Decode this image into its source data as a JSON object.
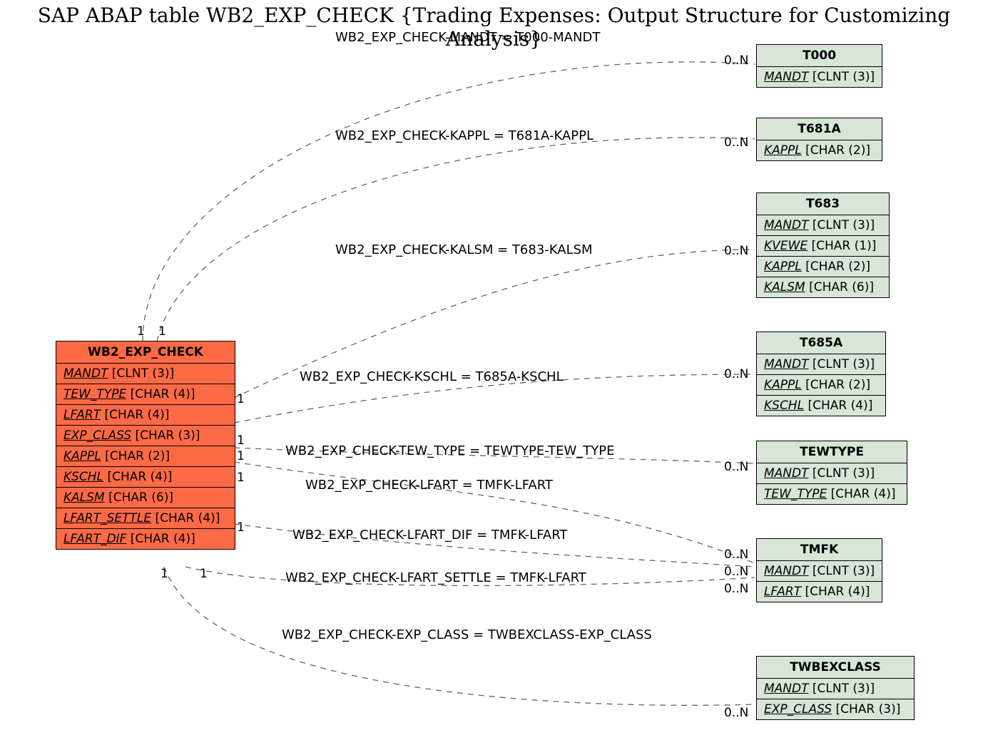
{
  "title": "SAP ABAP table WB2_EXP_CHECK {Trading Expenses: Output Structure for Customizing Analysis}",
  "source": {
    "name": "WB2_EXP_CHECK",
    "fields": [
      {
        "n": "MANDT",
        "t": "[CLNT (3)]"
      },
      {
        "n": "TEW_TYPE",
        "t": "[CHAR (4)]"
      },
      {
        "n": "LFART",
        "t": "[CHAR (4)]"
      },
      {
        "n": "EXP_CLASS",
        "t": "[CHAR (3)]"
      },
      {
        "n": "KAPPL",
        "t": "[CHAR (2)]"
      },
      {
        "n": "KSCHL",
        "t": "[CHAR (4)]"
      },
      {
        "n": "KALSM",
        "t": "[CHAR (6)]"
      },
      {
        "n": "LFART_SETTLE",
        "t": "[CHAR (4)]"
      },
      {
        "n": "LFART_DIF",
        "t": "[CHAR (4)]"
      }
    ]
  },
  "targets": {
    "t000": {
      "name": "T000",
      "fields": [
        {
          "n": "MANDT",
          "t": "[CLNT (3)]"
        }
      ]
    },
    "t681a": {
      "name": "T681A",
      "fields": [
        {
          "n": "KAPPL",
          "t": "[CHAR (2)]"
        }
      ]
    },
    "t683": {
      "name": "T683",
      "fields": [
        {
          "n": "MANDT",
          "t": "[CLNT (3)]"
        },
        {
          "n": "KVEWE",
          "t": "[CHAR (1)]"
        },
        {
          "n": "KAPPL",
          "t": "[CHAR (2)]"
        },
        {
          "n": "KALSM",
          "t": "[CHAR (6)]"
        }
      ]
    },
    "t685a": {
      "name": "T685A",
      "fields": [
        {
          "n": "MANDT",
          "t": "[CLNT (3)]"
        },
        {
          "n": "KAPPL",
          "t": "[CHAR (2)]"
        },
        {
          "n": "KSCHL",
          "t": "[CHAR (4)]"
        }
      ]
    },
    "tewtype": {
      "name": "TEWTYPE",
      "fields": [
        {
          "n": "MANDT",
          "t": "[CLNT (3)]"
        },
        {
          "n": "TEW_TYPE",
          "t": "[CHAR (4)]"
        }
      ]
    },
    "tmfk": {
      "name": "TMFK",
      "fields": [
        {
          "n": "MANDT",
          "t": "[CLNT (3)]"
        },
        {
          "n": "LFART",
          "t": "[CHAR (4)]"
        }
      ]
    },
    "twbexclass": {
      "name": "TWBEXCLASS",
      "fields": [
        {
          "n": "MANDT",
          "t": "[CLNT (3)]"
        },
        {
          "n": "EXP_CLASS",
          "t": "[CHAR (3)]"
        }
      ]
    }
  },
  "relations": {
    "r_mandt": "WB2_EXP_CHECK-MANDT = T000-MANDT",
    "r_kappl": "WB2_EXP_CHECK-KAPPL = T681A-KAPPL",
    "r_kalsm": "WB2_EXP_CHECK-KALSM = T683-KALSM",
    "r_kschl": "WB2_EXP_CHECK-KSCHL = T685A-KSCHL",
    "r_tew": "WB2_EXP_CHECK-TEW_TYPE = TEWTYPE-TEW_TYPE",
    "r_lfart": "WB2_EXP_CHECK-LFART = TMFK-LFART",
    "r_lfdif": "WB2_EXP_CHECK-LFART_DIF = TMFK-LFART",
    "r_lfset": "WB2_EXP_CHECK-LFART_SETTLE = TMFK-LFART",
    "r_expc": "WB2_EXP_CHECK-EXP_CLASS = TWBEXCLASS-EXP_CLASS"
  },
  "card": {
    "one": "1",
    "many": "0..N"
  }
}
